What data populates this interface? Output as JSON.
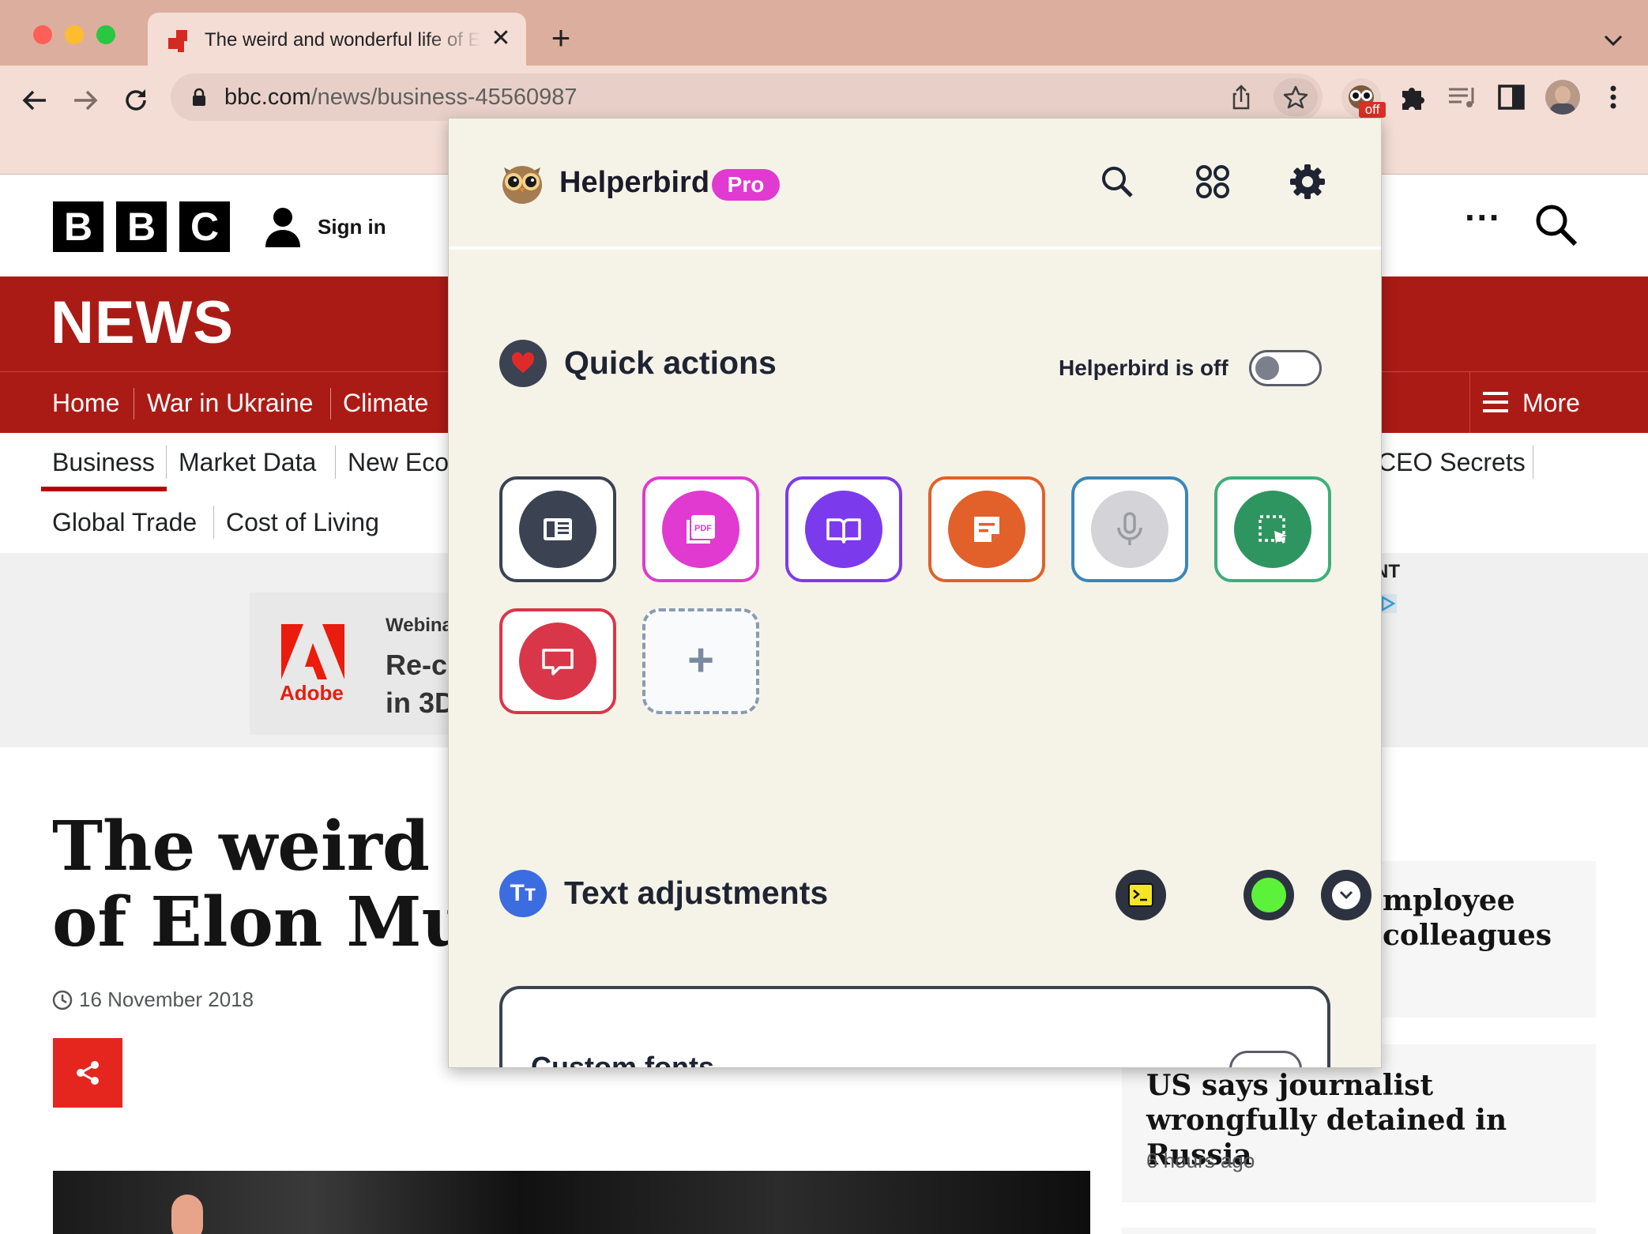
{
  "browser": {
    "tab_title": "The weird and wonderful life of Elon Musk",
    "tab_close": "✕",
    "new_tab": "+",
    "url_host": "bbc.com",
    "url_path": "/news/business-45560987",
    "extension_badge": "off"
  },
  "bbc": {
    "logo_letters": [
      "B",
      "B",
      "C"
    ],
    "sign_in": "Sign in",
    "news_title": "NEWS",
    "more_dots": "···",
    "nav": [
      "Home",
      "War in Ukraine",
      "Climate"
    ],
    "nav_more": "More",
    "sub_nav": [
      "Business",
      "Market Data",
      "New Eco"
    ],
    "sub_nav_right": "CEO Secrets",
    "sub_nav_row2": [
      "Global Trade",
      "Cost of Living"
    ],
    "ad": {
      "brand": "Adobe",
      "line1": "Webina",
      "line2": "Re-cr",
      "line3": "in 3D",
      "right_label": "NT"
    },
    "headline_line1": "The weird a",
    "headline_line2": "of Elon Mus",
    "date": "16 November 2018",
    "side_stories": [
      {
        "line1": "mployee",
        "line2": "colleagues"
      },
      {
        "title": "US says journalist wrongfully detained in Russia",
        "time": "6 hours ago"
      }
    ]
  },
  "helperbird": {
    "brand": "Helperbird",
    "pro_badge": "Pro",
    "header_icons": [
      "search-icon",
      "apps-grid-icon",
      "settings-gear-icon"
    ],
    "quick_actions": {
      "title": "Quick actions",
      "status_label": "Helperbird is off",
      "enabled": false,
      "tiles": [
        {
          "name": "reader-mode",
          "icon": "reader-icon",
          "color": "#3b4252"
        },
        {
          "name": "pdf",
          "icon": "pdf-icon",
          "label": "PDF",
          "color": "#e03ad0"
        },
        {
          "name": "dictionary",
          "icon": "book-icon",
          "color": "#7c3aed"
        },
        {
          "name": "notes",
          "icon": "note-icon",
          "color": "#e2602a"
        },
        {
          "name": "dictation",
          "icon": "microphone-icon",
          "color": "#d4d4d8"
        },
        {
          "name": "screenshot",
          "icon": "selection-icon",
          "color": "#2f9560"
        },
        {
          "name": "speech-bubble",
          "icon": "chat-bubble-icon",
          "color": "#d9364a"
        },
        {
          "name": "add-action",
          "icon": "plus-icon",
          "label": "+"
        }
      ]
    },
    "text_adjustments": {
      "title": "Text adjustments",
      "icon_letters": "Tт",
      "buttons": [
        "terminal-icon",
        "green-status-icon",
        "chevron-down-icon"
      ],
      "card_label": "Custom fonts"
    }
  }
}
